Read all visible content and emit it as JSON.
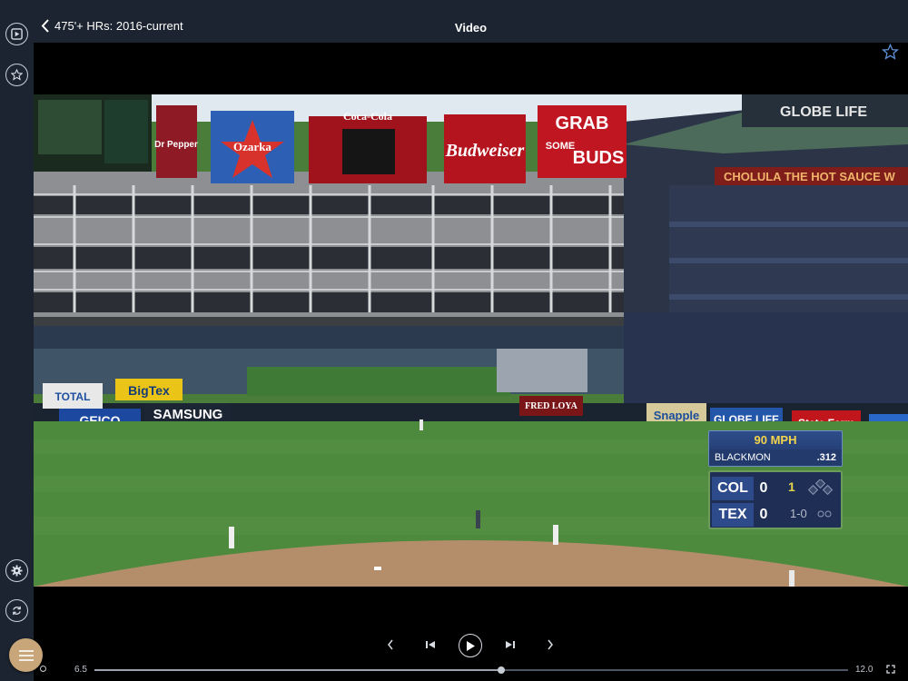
{
  "header": {
    "back_label": "475'+ HRs: 2016-current",
    "title": "Video"
  },
  "rail": {
    "top_icons": [
      "video-icon",
      "star-icon"
    ],
    "bottom_icons": [
      "gear-icon",
      "refresh-icon"
    ],
    "menu_icon": "hamburger-icon"
  },
  "video": {
    "signs": {
      "budweiser": "Budweiser",
      "grab": "GRAB",
      "some": "SOME",
      "buds": "BUDS",
      "cocacola": "Coca-Cola",
      "ozarka": "Ozarka",
      "drpepper": "Dr Pepper",
      "globelife": "GLOBE LIFE",
      "cholula": "CHOLULA THE HOT SAUCE W",
      "geico": "GEICO",
      "samsung": "SAMSUNG",
      "bigtex": "BigTex",
      "total": "TOTAL",
      "fredloya": "FRED LOYA",
      "snapple": "Snapple",
      "globelife2": "GLOBE LIFE",
      "statefarm": "State Farm"
    }
  },
  "scorebug": {
    "pitch_speed": "90 MPH",
    "batter_name": "BLACKMON",
    "batter_avg": ".312",
    "away_team": "COL",
    "away_score": "0",
    "home_team": "TEX",
    "home_score": "0",
    "inning": "1",
    "count": "1-0"
  },
  "controls": {
    "time_start": "6.5",
    "time_end": "12.0",
    "progress": 0.54
  },
  "colors": {
    "rail": "#1b2430",
    "accent": "#c8a67a"
  }
}
